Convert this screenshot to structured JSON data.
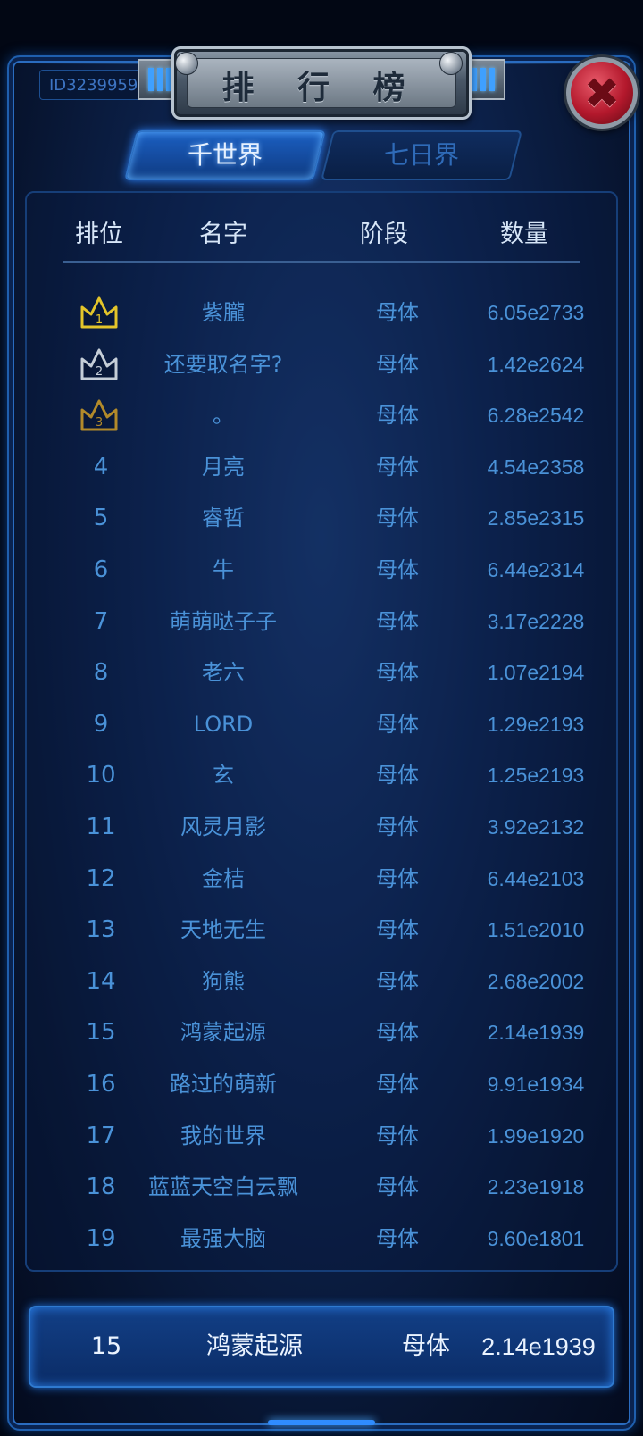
{
  "window": {
    "title": "排 行 榜",
    "player_id": "ID3239959"
  },
  "tabs": [
    {
      "label": "千世界",
      "active": true
    },
    {
      "label": "七日界",
      "active": false
    }
  ],
  "columns": {
    "rank": "排位",
    "name": "名字",
    "stage": "阶段",
    "quantity": "数量"
  },
  "crown_colors": {
    "1": "#e4c52a",
    "2": "#c5ced8",
    "3": "#b28a2a"
  },
  "rows": [
    {
      "rank": "1",
      "name": "紫朧",
      "stage": "母体",
      "quantity": "6.05e2733",
      "crown": true
    },
    {
      "rank": "2",
      "name": "还要取名字?",
      "stage": "母体",
      "quantity": "1.42e2624",
      "crown": true
    },
    {
      "rank": "3",
      "name": "。",
      "stage": "母体",
      "quantity": "6.28e2542",
      "crown": true
    },
    {
      "rank": "4",
      "name": "月亮",
      "stage": "母体",
      "quantity": "4.54e2358"
    },
    {
      "rank": "5",
      "name": "睿哲",
      "stage": "母体",
      "quantity": "2.85e2315"
    },
    {
      "rank": "6",
      "name": "牛",
      "stage": "母体",
      "quantity": "6.44e2314"
    },
    {
      "rank": "7",
      "name": "萌萌哒子子",
      "stage": "母体",
      "quantity": "3.17e2228"
    },
    {
      "rank": "8",
      "name": "老六",
      "stage": "母体",
      "quantity": "1.07e2194"
    },
    {
      "rank": "9",
      "name": "LORD",
      "stage": "母体",
      "quantity": "1.29e2193"
    },
    {
      "rank": "10",
      "name": "玄",
      "stage": "母体",
      "quantity": "1.25e2193"
    },
    {
      "rank": "11",
      "name": "风灵月影",
      "stage": "母体",
      "quantity": "3.92e2132"
    },
    {
      "rank": "12",
      "name": "金桔",
      "stage": "母体",
      "quantity": "6.44e2103"
    },
    {
      "rank": "13",
      "name": "天地无生",
      "stage": "母体",
      "quantity": "1.51e2010"
    },
    {
      "rank": "14",
      "name": "狗熊",
      "stage": "母体",
      "quantity": "2.68e2002"
    },
    {
      "rank": "15",
      "name": "鸿蒙起源",
      "stage": "母体",
      "quantity": "2.14e1939"
    },
    {
      "rank": "16",
      "name": "路过的萌新",
      "stage": "母体",
      "quantity": "9.91e1934"
    },
    {
      "rank": "17",
      "name": "我的世界",
      "stage": "母体",
      "quantity": "1.99e1920"
    },
    {
      "rank": "18",
      "name": "蓝蓝天空白云飘",
      "stage": "母体",
      "quantity": "2.23e1918"
    },
    {
      "rank": "19",
      "name": "最强大脑",
      "stage": "母体",
      "quantity": "9.60e1801"
    }
  ],
  "my_rank": {
    "rank": "15",
    "name": "鸿蒙起源",
    "stage": "母体",
    "quantity": "2.14e1939"
  }
}
